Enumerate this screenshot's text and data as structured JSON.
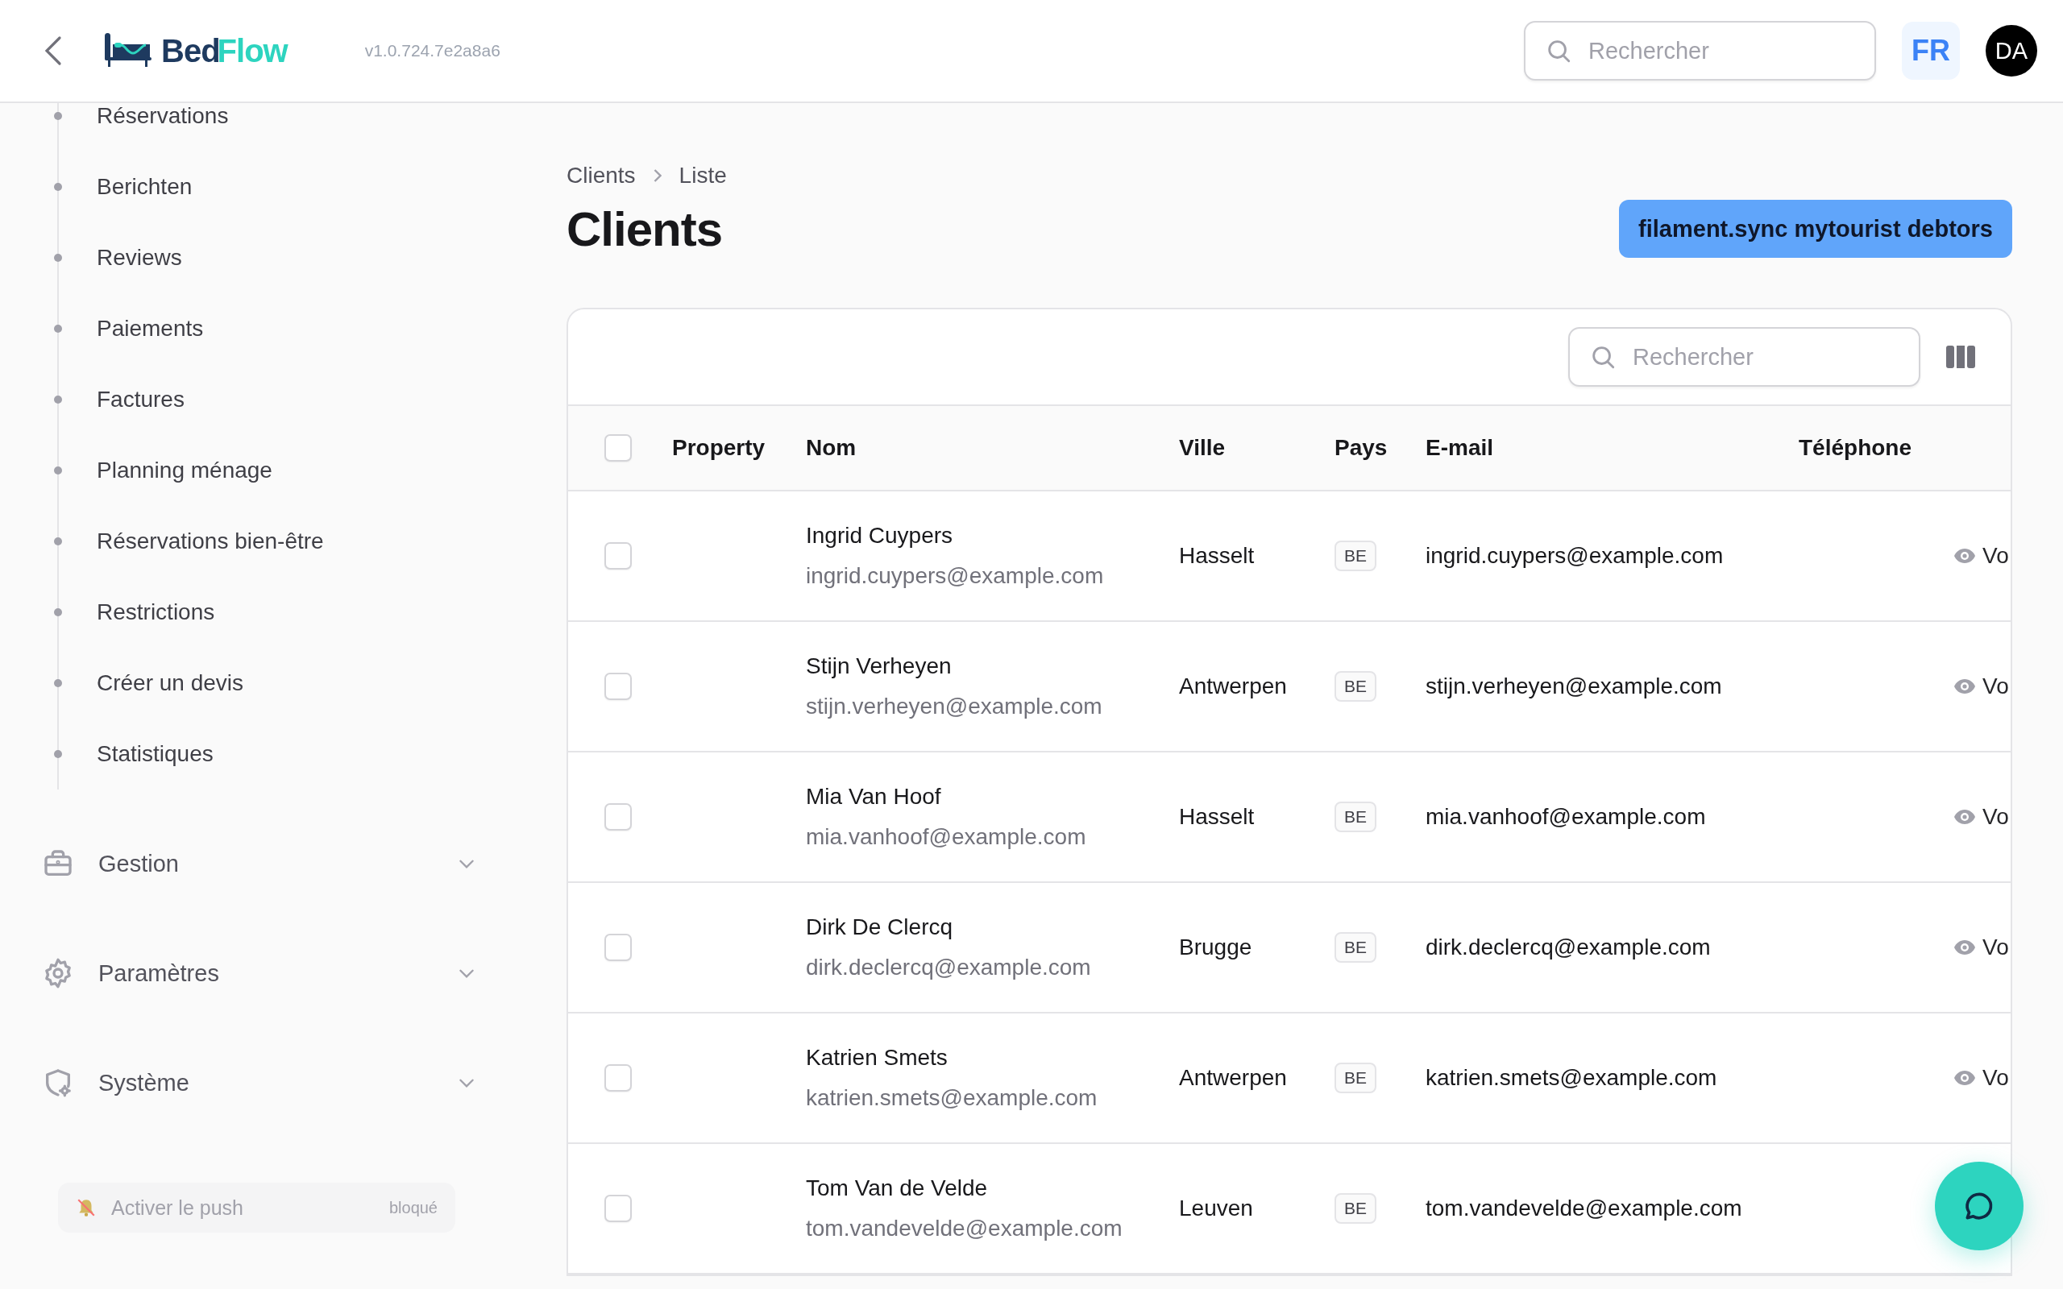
{
  "header": {
    "logo": {
      "part_1": "Bed",
      "part_2": "Flow"
    },
    "version": "v1.0.724.7e2a8a6",
    "search": {
      "placeholder": "Rechercher"
    },
    "language": "FR",
    "avatar": "DA"
  },
  "sidebar": {
    "items": [
      {
        "label": "Réservations"
      },
      {
        "label": "Berichten"
      },
      {
        "label": "Reviews"
      },
      {
        "label": "Paiements"
      },
      {
        "label": "Factures"
      },
      {
        "label": "Planning ménage"
      },
      {
        "label": "Réservations bien-être"
      },
      {
        "label": "Restrictions"
      },
      {
        "label": "Créer un devis"
      },
      {
        "label": "Statistiques"
      }
    ],
    "groups": [
      {
        "kind": "briefcase",
        "label": "Gestion",
        "expanded": false
      },
      {
        "kind": "gear",
        "label": "Paramètres",
        "expanded": false
      },
      {
        "kind": "shield",
        "label": "Système",
        "expanded": false
      }
    ],
    "push": {
      "label": "Activer le push",
      "status": "bloqué"
    }
  },
  "breadcrumbs": [
    "Clients",
    "Liste"
  ],
  "title": "Clients",
  "action_button": "filament.sync mytourist debtors",
  "table": {
    "search": {
      "placeholder": "Rechercher"
    },
    "all_checked": false,
    "columns": [
      "Property",
      "Nom",
      "Ville",
      "Pays",
      "E-mail",
      "Téléphone"
    ],
    "rows": [
      {
        "checked": false,
        "name": "Ingrid Cuypers",
        "name_email": "ingrid.cuypers@example.com",
        "city": "Hasselt",
        "country": "BE",
        "email": "ingrid.cuypers@example.com",
        "action": "Vo"
      },
      {
        "checked": false,
        "name": "Stijn Verheyen",
        "name_email": "stijn.verheyen@example.com",
        "city": "Antwerpen",
        "country": "BE",
        "email": "stijn.verheyen@example.com",
        "action": "Vo"
      },
      {
        "checked": false,
        "name": "Mia Van Hoof",
        "name_email": "mia.vanhoof@example.com",
        "city": "Hasselt",
        "country": "BE",
        "email": "mia.vanhoof@example.com",
        "action": "Vo"
      },
      {
        "checked": false,
        "name": "Dirk De Clercq",
        "name_email": "dirk.declercq@example.com",
        "city": "Brugge",
        "country": "BE",
        "email": "dirk.declercq@example.com",
        "action": "Vo"
      },
      {
        "checked": false,
        "name": "Katrien Smets",
        "name_email": "katrien.smets@example.com",
        "city": "Antwerpen",
        "country": "BE",
        "email": "katrien.smets@example.com",
        "action": "Vo"
      },
      {
        "checked": false,
        "name": "Tom Van de Velde",
        "name_email": "tom.vandevelde@example.com",
        "city": "Leuven",
        "country": "BE",
        "email": "tom.vandevelde@example.com"
      }
    ]
  }
}
